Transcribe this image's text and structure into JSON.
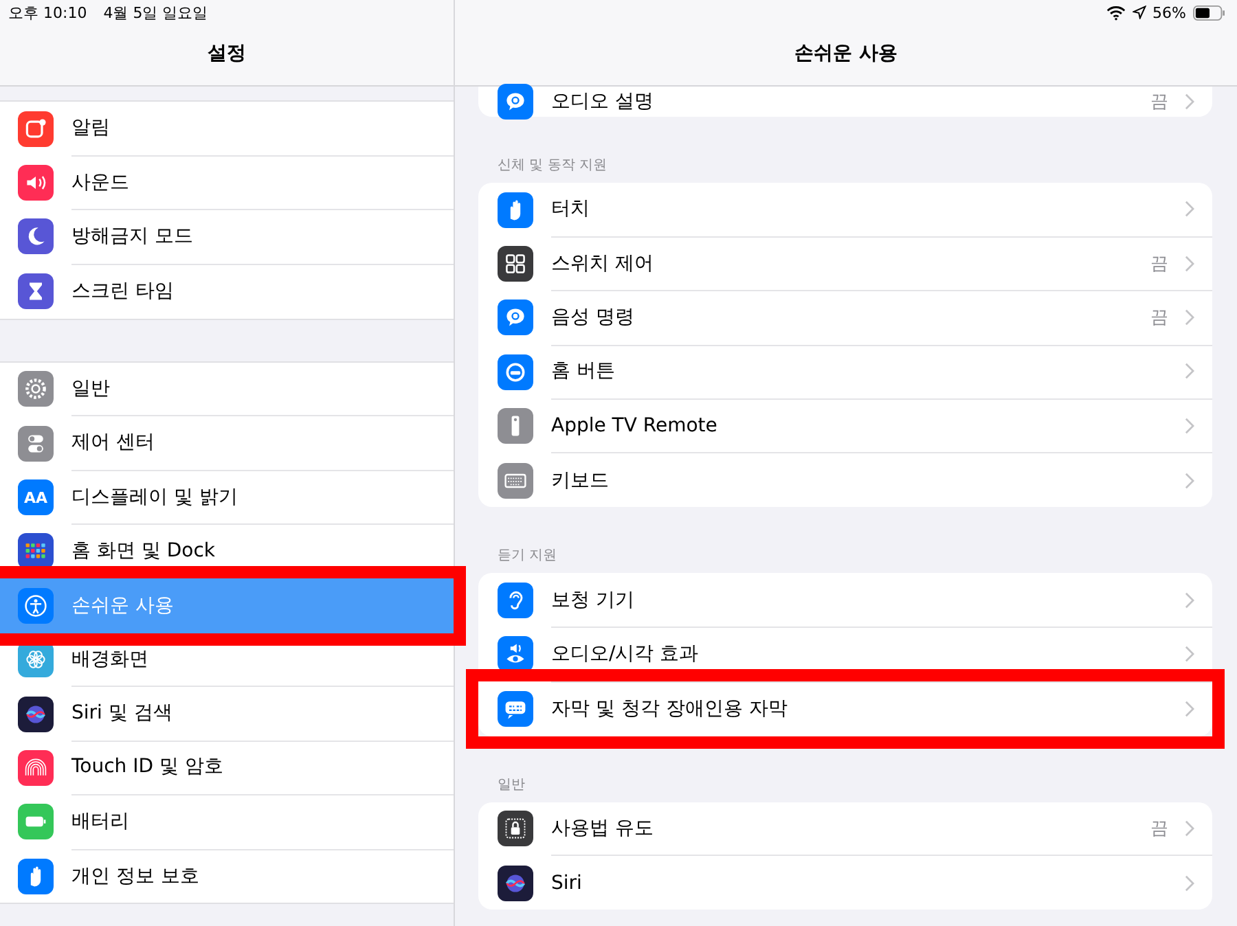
{
  "status_bar": {
    "time": "오후 10:10",
    "date": "4월 5일 일요일",
    "battery": "56%"
  },
  "sidebar": {
    "title": "설정",
    "groups": [
      [
        {
          "label": "알림",
          "selected": false,
          "marked": false
        },
        {
          "label": "사운드",
          "selected": false,
          "marked": false
        },
        {
          "label": "방해금지 모드",
          "selected": false,
          "marked": false
        },
        {
          "label": "스크린 타임",
          "selected": false,
          "marked": false
        }
      ],
      [
        {
          "label": "일반",
          "selected": false,
          "marked": false
        },
        {
          "label": "제어 센터",
          "selected": false,
          "marked": false
        },
        {
          "label": "디스플레이 및 밝기",
          "icon_text": "AA",
          "selected": false,
          "marked": false
        },
        {
          "label": "홈 화면 및 Dock",
          "selected": false,
          "marked": false
        },
        {
          "label": "손쉬운 사용",
          "selected": true,
          "marked": true
        },
        {
          "label": "배경화면",
          "selected": false,
          "marked": false
        },
        {
          "label": "Siri 및 검색",
          "selected": false,
          "marked": false
        },
        {
          "label": "Touch ID 및 암호",
          "selected": false,
          "marked": false
        },
        {
          "label": "배터리",
          "selected": false,
          "marked": false
        },
        {
          "label": "개인 정보 보호",
          "selected": false,
          "marked": false
        }
      ]
    ]
  },
  "detail": {
    "title": "손쉬운 사용",
    "sections": [
      {
        "items": [
          {
            "label": "오디오 설명",
            "value": "끔",
            "marked": false
          }
        ]
      },
      {
        "header": "신체 및 동작 지원",
        "items": [
          {
            "label": "터치",
            "marked": false
          },
          {
            "label": "스위치 제어",
            "value": "끔",
            "marked": false
          },
          {
            "label": "음성 명령",
            "value": "끔",
            "marked": false
          },
          {
            "label": "홈 버튼",
            "marked": false
          },
          {
            "label": "Apple TV Remote",
            "marked": false
          },
          {
            "label": "키보드",
            "marked": false
          }
        ]
      },
      {
        "header": "듣기 지원",
        "items": [
          {
            "label": "보청 기기",
            "marked": false
          },
          {
            "label": "오디오/시각 효과",
            "marked": false
          },
          {
            "label": "자막 및 청각 장애인용 자막",
            "marked": true
          }
        ]
      },
      {
        "header": "일반",
        "items": [
          {
            "label": "사용법 유도",
            "value": "끔",
            "marked": false
          },
          {
            "label": "Siri",
            "marked": false
          }
        ]
      }
    ]
  }
}
